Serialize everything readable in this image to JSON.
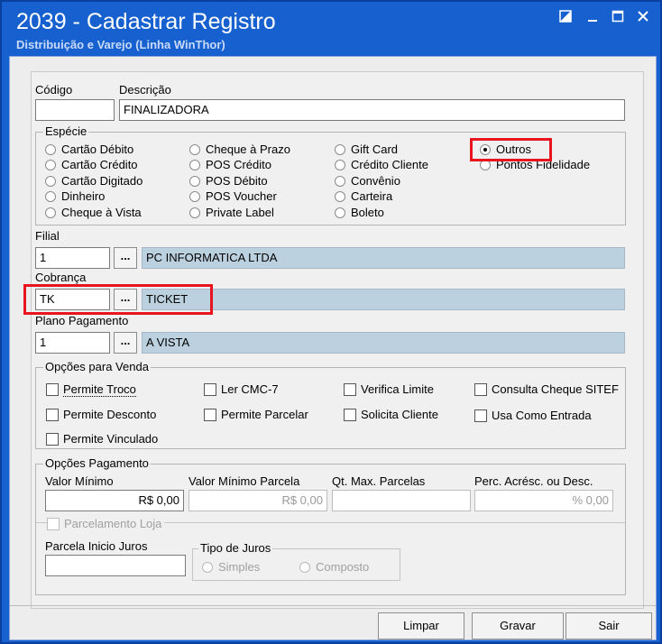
{
  "window": {
    "title": "2039 - Cadastrar Registro",
    "subtitle": "Distribuição e Varejo (Linha WinThor)"
  },
  "fields": {
    "codigo_label": "Código",
    "codigo_value": "",
    "descricao_label": "Descrição",
    "descricao_value": "FINALIZADORA"
  },
  "especie": {
    "legend": "Espécie",
    "options": [
      {
        "label": "Cartão Débito",
        "selected": false
      },
      {
        "label": "Cartão Crédito",
        "selected": false
      },
      {
        "label": "Cartão Digitado",
        "selected": false
      },
      {
        "label": "Dinheiro",
        "selected": false
      },
      {
        "label": "Cheque à Vista",
        "selected": false
      },
      {
        "label": "Cheque à Prazo",
        "selected": false
      },
      {
        "label": "POS Crédito",
        "selected": false
      },
      {
        "label": "POS Débito",
        "selected": false
      },
      {
        "label": "POS Voucher",
        "selected": false
      },
      {
        "label": "Private Label",
        "selected": false
      },
      {
        "label": "Gift Card",
        "selected": false
      },
      {
        "label": "Crédito Cliente",
        "selected": false
      },
      {
        "label": "Convênio",
        "selected": false
      },
      {
        "label": "Carteira",
        "selected": false
      },
      {
        "label": "Boleto",
        "selected": false
      },
      {
        "label": "Outros",
        "selected": true
      },
      {
        "label": "Pontos Fidelidade",
        "selected": false
      }
    ]
  },
  "filial": {
    "label": "Filial",
    "code": "1",
    "name": "PC INFORMATICA LTDA"
  },
  "cobranca": {
    "label": "Cobrança",
    "code": "TK",
    "name": "TICKET"
  },
  "plano": {
    "label": "Plano Pagamento",
    "code": "1",
    "name": "A VISTA"
  },
  "lookup_label": "...",
  "opcoes_venda": {
    "legend": "Opções para Venda",
    "items": [
      "Permite Troco",
      "Ler CMC-7",
      "Verifica Limite",
      "Consulta Cheque SITEF",
      "Permite Desconto",
      "Permite Parcelar",
      "Solicita Cliente",
      "Usa Como Entrada",
      "Permite Vinculado"
    ]
  },
  "opcoes_pagamento": {
    "legend": "Opções Pagamento",
    "valor_minimo_label": "Valor Mínimo",
    "valor_minimo_value": "R$ 0,00",
    "valor_minimo_parcela_label": "Valor Mínimo Parcela",
    "valor_minimo_parcela_value": "R$ 0,00",
    "qt_max_parcelas_label": "Qt. Max. Parcelas",
    "qt_max_parcelas_value": "",
    "perc_label": "Perc. Acrésc. ou Desc.",
    "perc_value": "% 0,00",
    "parcelamento_label": "Parcelamento Loja",
    "parcela_inicio_label": "Parcela Inicio Juros",
    "parcela_inicio_value": "",
    "tipo_juros_legend": "Tipo de Juros",
    "simples_label": "Simples",
    "composto_label": "Composto"
  },
  "buttons": {
    "limpar": "Limpar",
    "gravar": "Gravar",
    "sair": "Sair"
  },
  "colors": {
    "title_bar": "#1660cf",
    "readonly_field": "#bcd1df",
    "highlight": "#e8141e"
  }
}
